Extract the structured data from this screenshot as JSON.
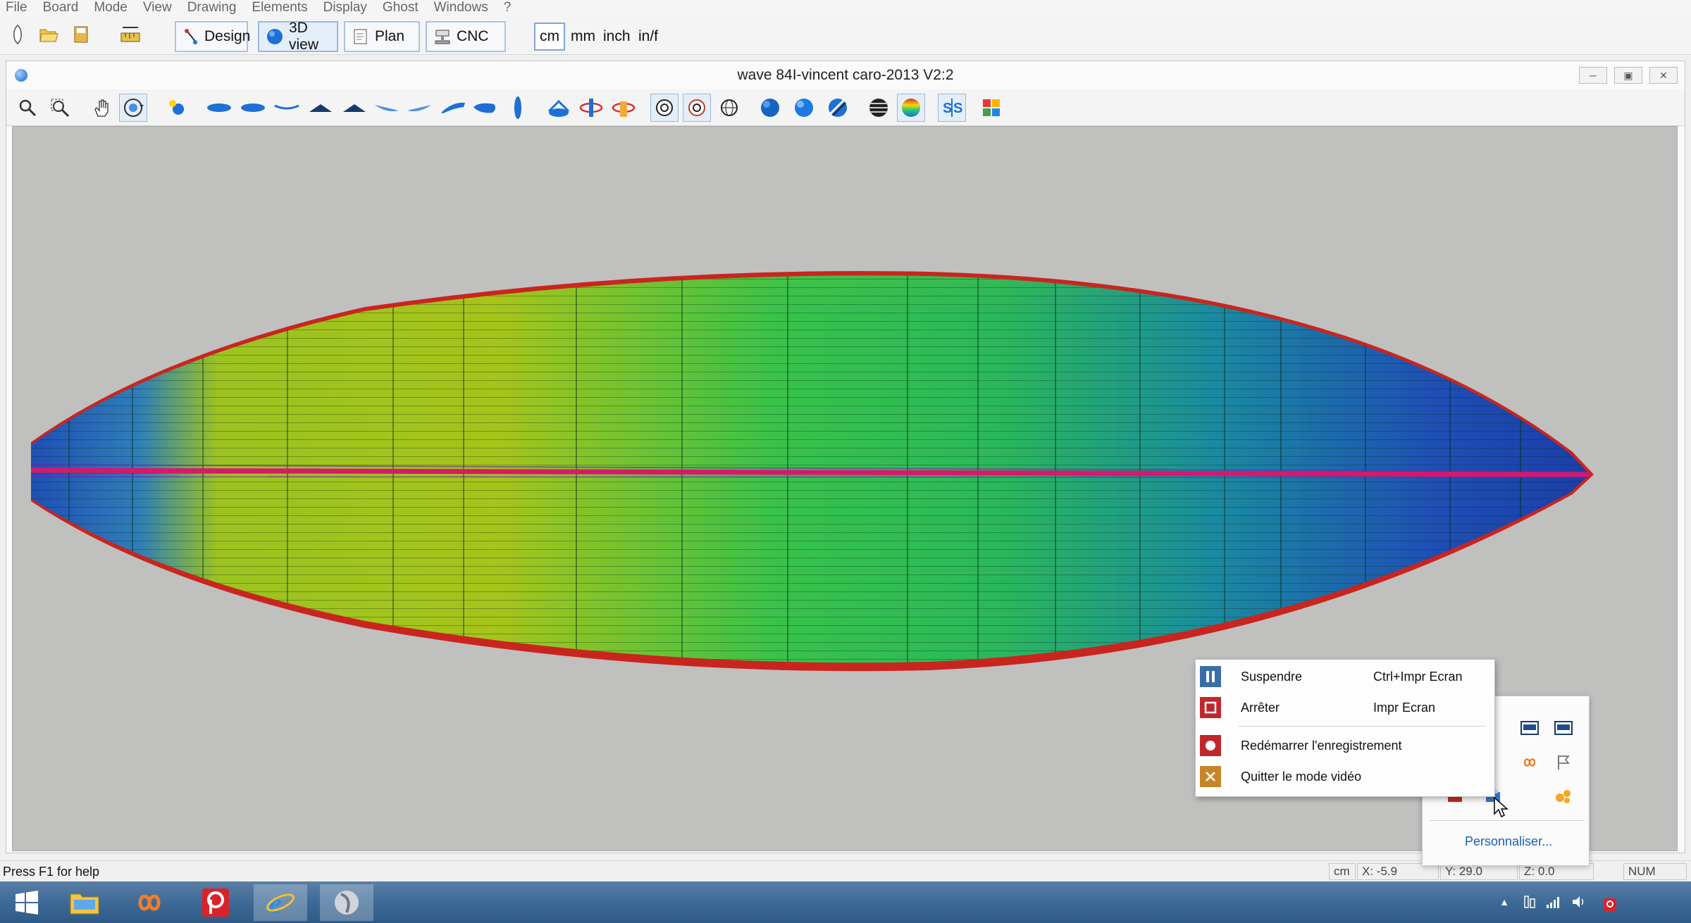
{
  "menu": [
    "File",
    "Board",
    "Mode",
    "View",
    "Drawing",
    "Elements",
    "Display",
    "Ghost",
    "Windows",
    "?"
  ],
  "toolbar": {
    "modes": [
      "Design",
      "3D view",
      "Plan",
      "CNC"
    ],
    "units": [
      "cm",
      "mm",
      "inch",
      "in/f"
    ],
    "active_mode": "3D view",
    "active_unit": "cm"
  },
  "window": {
    "title": "wave 84I-vincent caro-2013 V2:2"
  },
  "statusbar": {
    "help": "Press F1 for help",
    "unit": "cm",
    "x": "X: -5.9",
    "y": "Y: 29.0",
    "z": "Z: 0.0",
    "num": "NUM"
  },
  "context_menu": {
    "items": [
      {
        "label": "Suspendre",
        "shortcut": "Ctrl+Impr Ecran",
        "icon": "pause-icon"
      },
      {
        "label": "Arrêter",
        "shortcut": "Impr Ecran",
        "icon": "stop-icon"
      },
      {
        "label": "Redémarrer l'enregistrement",
        "shortcut": "",
        "icon": "record-icon"
      },
      {
        "label": "Quitter le mode vidéo",
        "shortcut": "",
        "icon": "close-icon"
      }
    ]
  },
  "tray_flyout": {
    "customize": "Personnaliser..."
  },
  "colors": {
    "accent": "#9ab8dc",
    "pause": "#3b6ea5",
    "stop": "#c0272d",
    "quit": "#c7852a"
  }
}
